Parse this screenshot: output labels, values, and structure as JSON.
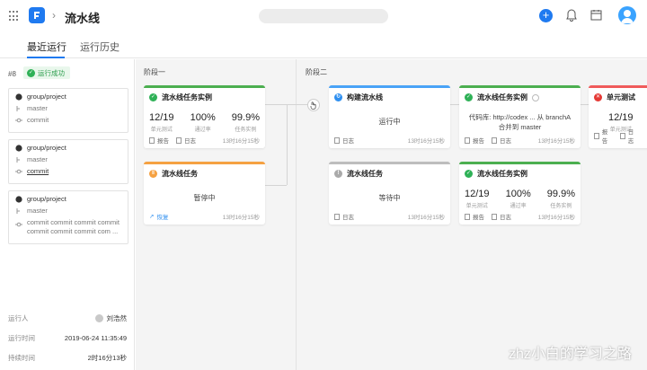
{
  "header": {
    "title": "流水线"
  },
  "tabs": [
    {
      "label": "最近运行"
    },
    {
      "label": "运行历史"
    }
  ],
  "run": {
    "number": "#8",
    "status": "运行成功"
  },
  "sources": [
    {
      "repo": "group/project",
      "branch": "master",
      "commit": "commit"
    },
    {
      "repo": "group/project",
      "branch": "master",
      "commit": "commit"
    },
    {
      "repo": "group/project",
      "branch": "master",
      "commit_lines": [
        "commit commit commit commit",
        "commit commit commit com ..."
      ]
    }
  ],
  "meta": [
    {
      "label": "运行人",
      "value": "刘浩然"
    },
    {
      "label": "运行时间",
      "value": "2019-06-24 11:35:49"
    },
    {
      "label": "持续时间",
      "value": "2时16分13秒"
    }
  ],
  "stages": [
    {
      "label": "阶段一"
    },
    {
      "label": "阶段二"
    }
  ],
  "common": {
    "report": "报告",
    "log": "日志",
    "retry": "恢复"
  },
  "cards": {
    "s1a": {
      "title": "流水线任务实例",
      "stats": [
        {
          "value": "12/19",
          "label": "单元测试"
        },
        {
          "value": "100%",
          "label": "通过率"
        },
        {
          "value": "99.9%",
          "label": "任务实例"
        }
      ],
      "time": "13时16分15秒"
    },
    "s1b": {
      "title": "流水线任务",
      "status": "暂停中",
      "time": "13时16分15秒"
    },
    "s2a": {
      "title": "构建流水线",
      "status": "运行中",
      "time": "13时16分15秒"
    },
    "s2b": {
      "title": "流水线任务",
      "status": "等待中",
      "time": "13时16分15秒"
    },
    "s3a": {
      "title": "流水线任务实例",
      "line1": "代码库: http://codex ... 从 branchA",
      "line2": "合并到 master",
      "time": "13时16分15秒"
    },
    "s3b": {
      "title": "流水线任务实例",
      "stats": [
        {
          "value": "12/19",
          "label": "单元测试"
        },
        {
          "value": "100%",
          "label": "通过率"
        },
        {
          "value": "99.9%",
          "label": "任务实例"
        }
      ],
      "time": "13时16分15秒"
    },
    "s4a": {
      "title": "单元测试",
      "stat_value": "12/19",
      "stat_label": "单元测试"
    }
  },
  "watermark": "zhz小白的学习之路"
}
